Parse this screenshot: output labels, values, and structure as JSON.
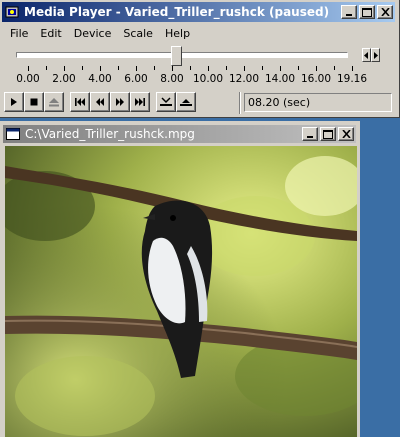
{
  "window": {
    "title": "Media Player - Varied_Triller_rushck (paused)"
  },
  "menu": [
    "File",
    "Edit",
    "Device",
    "Scale",
    "Help"
  ],
  "timeline": {
    "position_seconds": 8.2,
    "duration_seconds": 19.16,
    "tick_labels": [
      "0.00",
      "2.00",
      "4.00",
      "6.00",
      "8.00",
      "10.00",
      "12.00",
      "14.00",
      "16.00",
      "19.16"
    ]
  },
  "controls": {
    "play": "play-icon",
    "stop": "stop-icon",
    "eject": "eject-icon",
    "prev": "skip-start-icon",
    "rewind": "rewind-icon",
    "forward": "fast-forward-icon",
    "next": "skip-end-icon",
    "mark_in": "mark-in-icon",
    "mark_out": "mark-out-icon"
  },
  "time_display": "08.20 (sec)",
  "video_window": {
    "title": "C:\\Varied_Triller_rushck.mpg"
  },
  "colors": {
    "desktop": "#3a6ea5",
    "face": "#d4d0c8",
    "active_title": "#0a246a",
    "inactive_title": "#808080"
  }
}
